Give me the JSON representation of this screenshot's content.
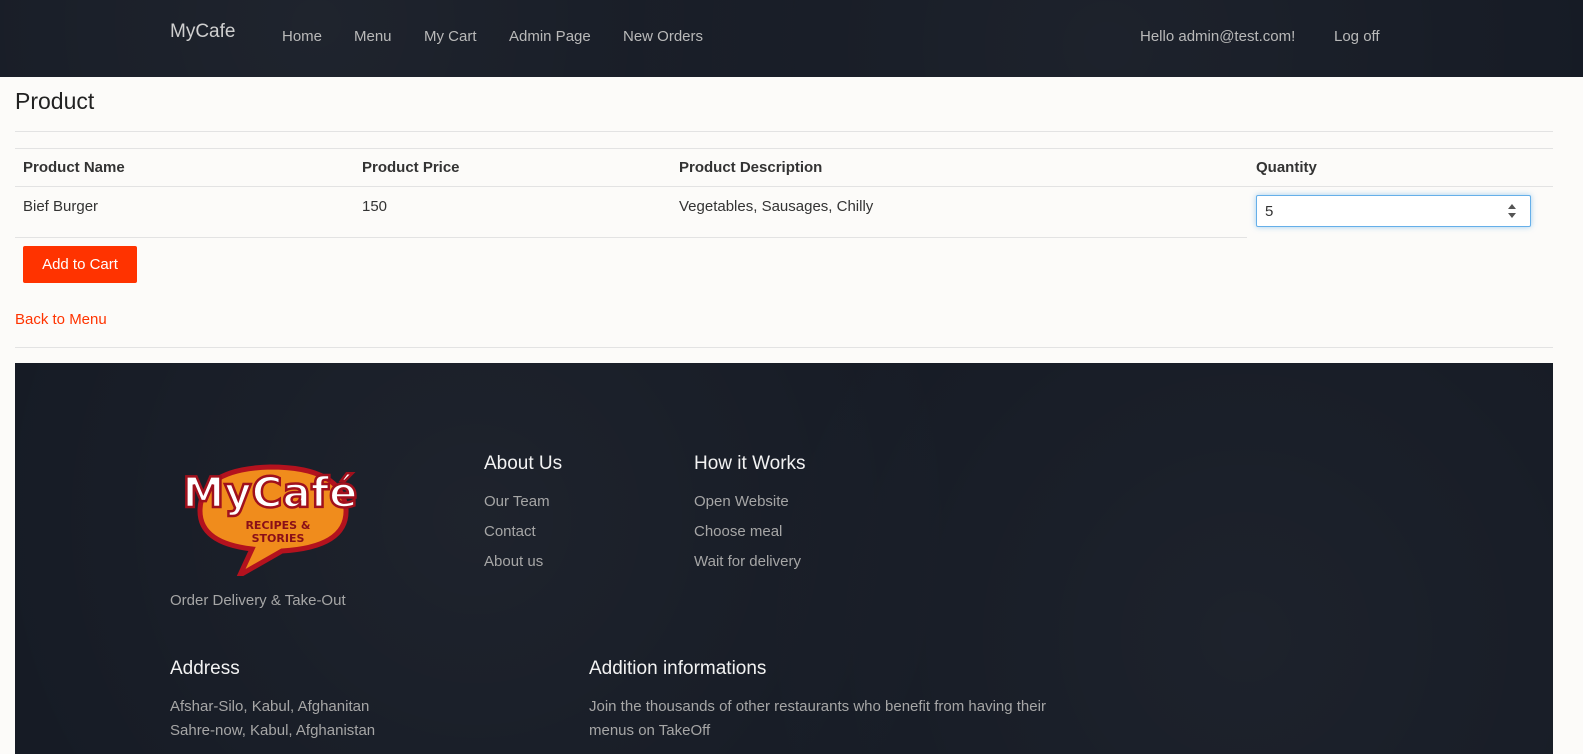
{
  "navbar": {
    "brand": "MyCafe",
    "links": [
      "Home",
      "Menu",
      "My Cart",
      "Admin Page",
      "New Orders"
    ],
    "greeting": "Hello admin@test.com!",
    "logoff": "Log off"
  },
  "page": {
    "title": "Product",
    "table": {
      "headers": [
        "Product Name",
        "Product Price",
        "Product Description",
        "Quantity"
      ],
      "row": {
        "name": "Bief Burger",
        "price": "150",
        "description": "Vegetables, Sausages, Chilly",
        "quantity": "5"
      }
    },
    "add_button": "Add to Cart",
    "back_link": "Back to Menu"
  },
  "footer": {
    "logo_title": "MyCafé",
    "logo_sub_line1": "RECIPES &",
    "logo_sub_line2": "STORIES",
    "tagline": "Order Delivery & Take-Out",
    "about": {
      "title": "About Us",
      "links": [
        "Our Team",
        "Contact",
        "About us"
      ]
    },
    "how": {
      "title": "How it Works",
      "links": [
        "Open Website",
        "Choose meal",
        "Wait for delivery"
      ]
    },
    "address": {
      "title": "Address",
      "lines": [
        "Afshar-Silo, Kabul, Afghanitan",
        "Sahre-now, Kabul, Afghanistan"
      ]
    },
    "additional": {
      "title": "Addition informations",
      "lines": [
        "Join the thousands of other restaurants who benefit from having their",
        "menus on TakeOff"
      ]
    }
  },
  "colors": {
    "accent": "#ff3300",
    "navbar_bg": "#161b25",
    "page_bg": "#fcfbf9"
  }
}
